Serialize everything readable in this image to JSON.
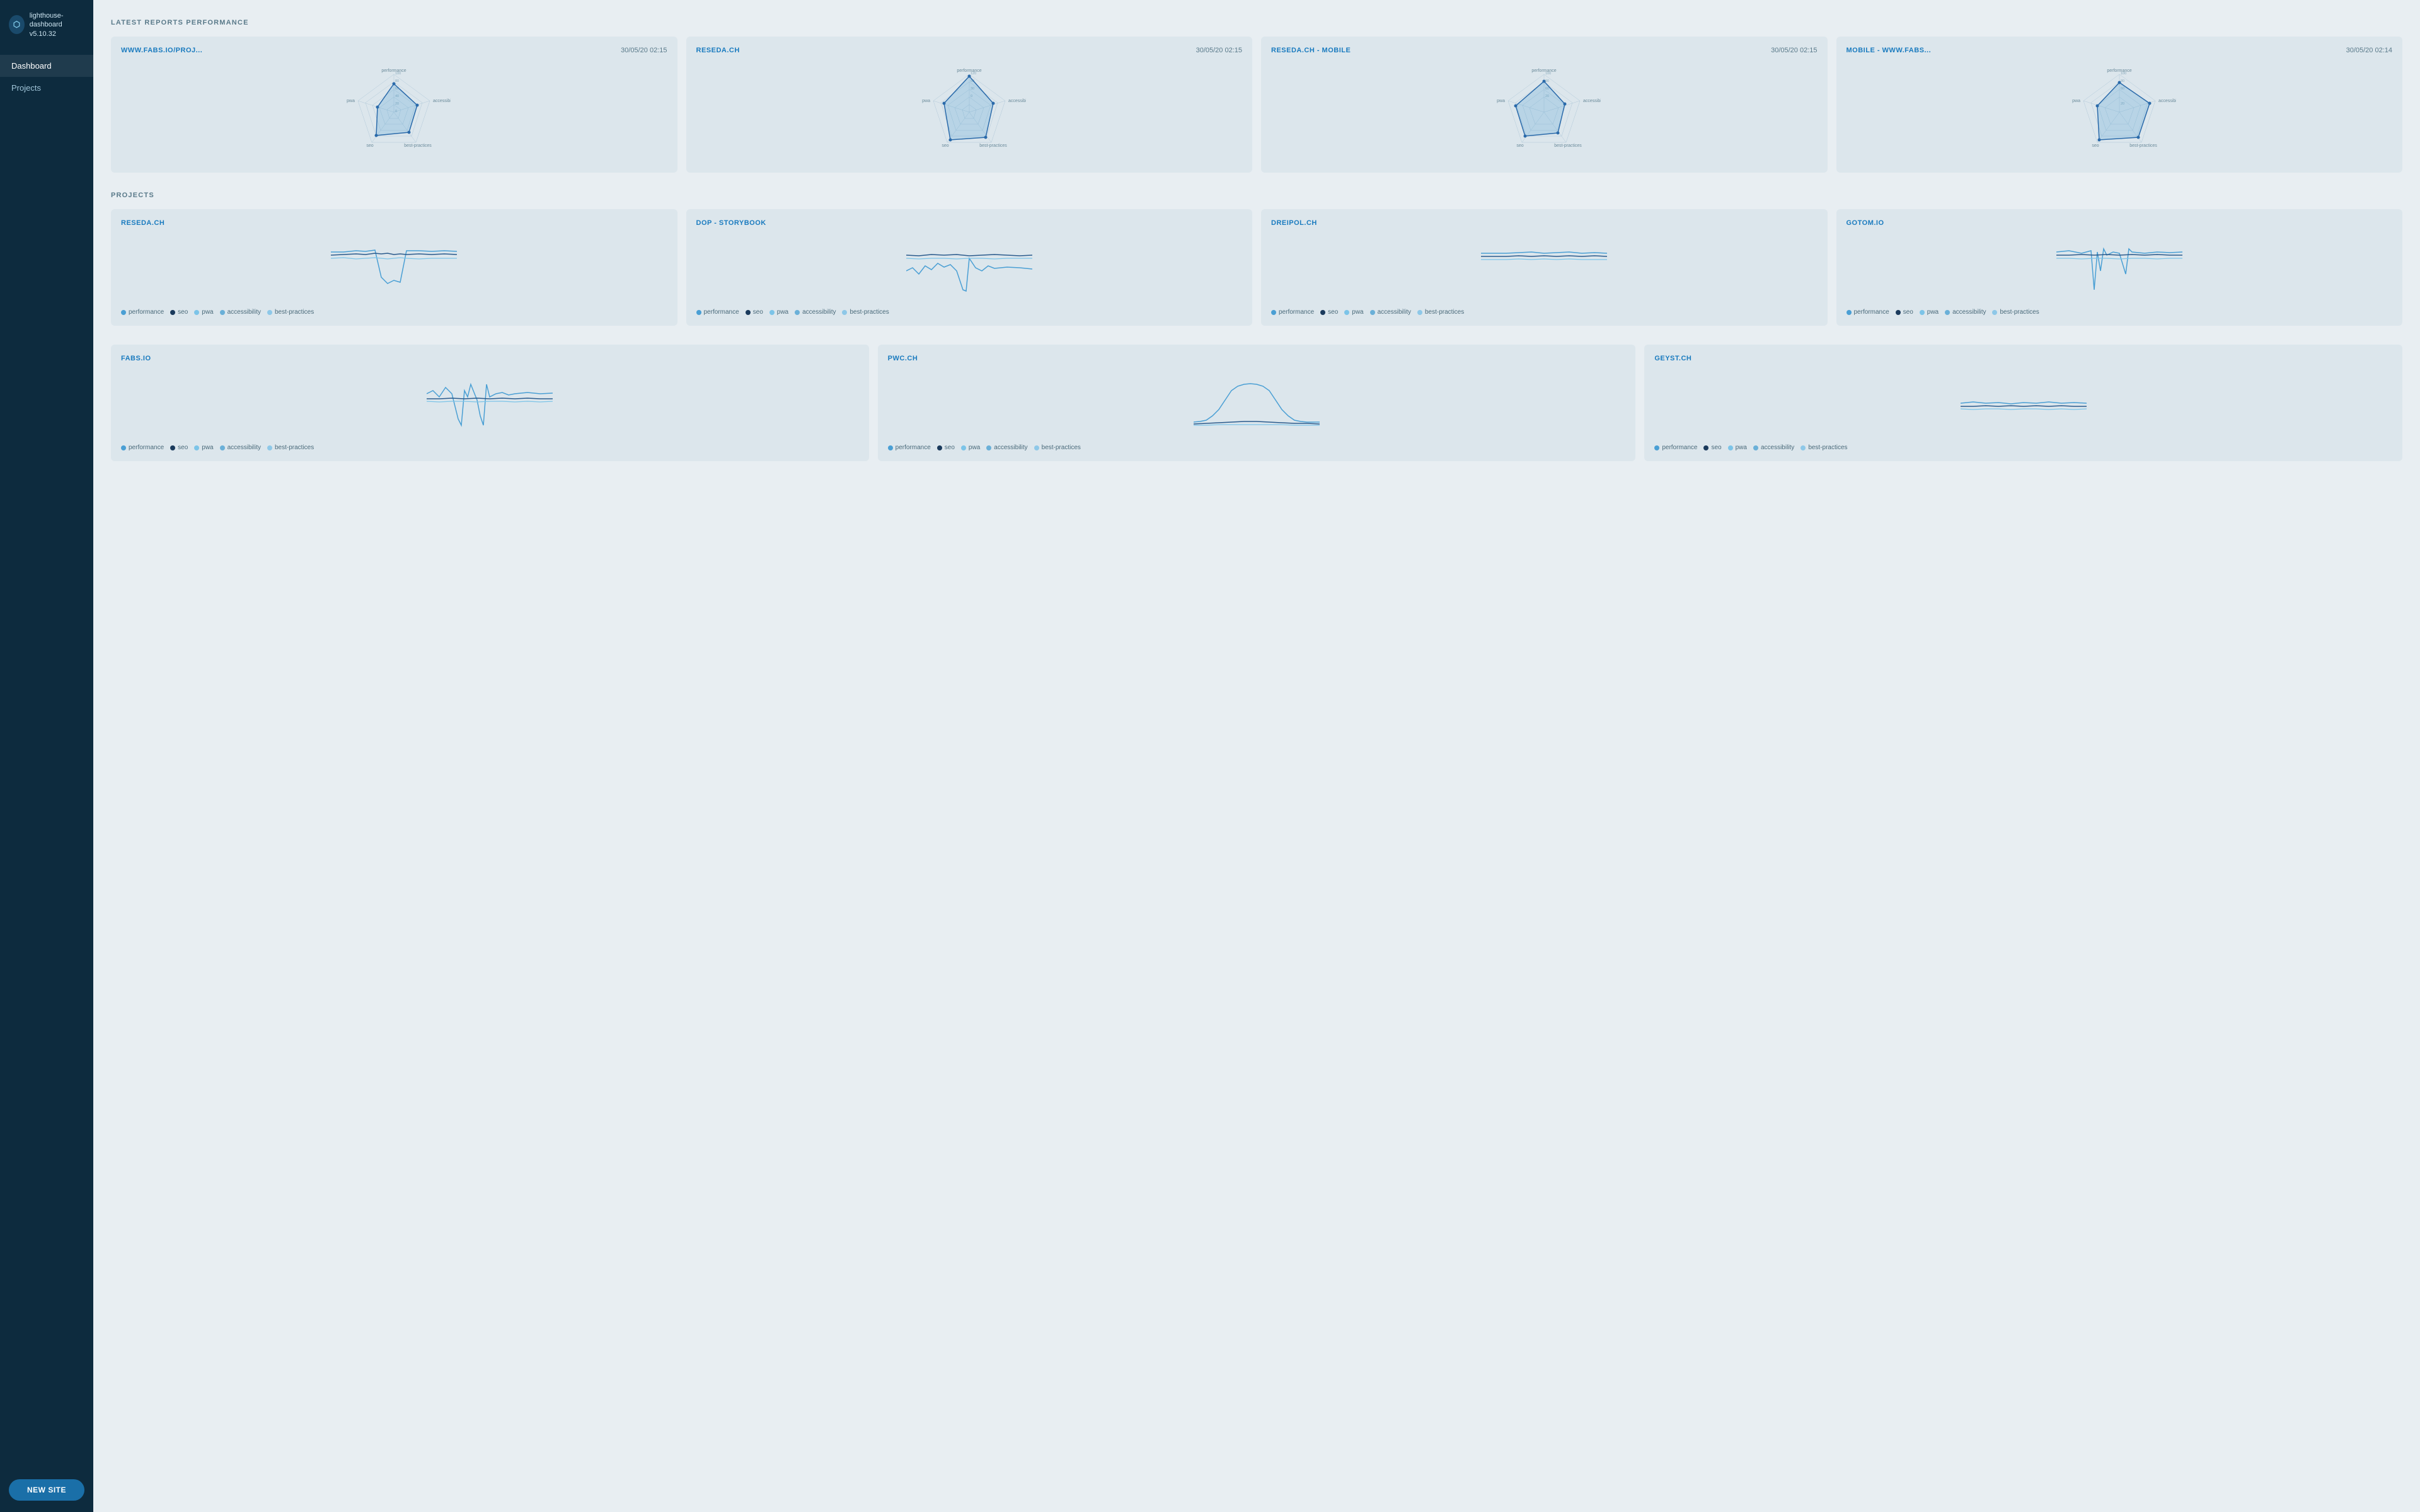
{
  "app": {
    "name": "lighthouse-dashboard",
    "version": "v5.10.32"
  },
  "sidebar": {
    "nav_items": [
      {
        "id": "dashboard",
        "label": "Dashboard",
        "active": true
      },
      {
        "id": "projects",
        "label": "Projects",
        "active": false
      }
    ],
    "new_site_label": "NEW SITE"
  },
  "latest_reports": {
    "section_title": "LATEST REPORTS PERFORMANCE",
    "cards": [
      {
        "id": "report-1",
        "title": "WWW.FABS.IO/PROJ...",
        "date": "30/05/20 02:15",
        "radar_data": {
          "performance": 75,
          "accessibility": 70,
          "best_practices": 65,
          "seo": 80,
          "pwa": 45
        }
      },
      {
        "id": "report-2",
        "title": "RESEDA.CH",
        "date": "30/05/20 02:15",
        "radar_data": {
          "performance": 95,
          "accessibility": 75,
          "best_practices": 70,
          "seo": 80,
          "pwa": 60
        }
      },
      {
        "id": "report-3",
        "title": "RESEDA.CH - MOBILE",
        "date": "30/05/20 02:15",
        "radar_data": {
          "performance": 82,
          "accessibility": 72,
          "best_practices": 68,
          "seo": 78,
          "pwa": 50
        }
      },
      {
        "id": "report-4",
        "title": "MOBILE - WWW.FABS...",
        "date": "30/05/20 02:14",
        "radar_data": {
          "performance": 78,
          "accessibility": 85,
          "best_practices": 75,
          "seo": 88,
          "pwa": 55
        }
      }
    ]
  },
  "projects": {
    "section_title": "PROJECTS",
    "cards": [
      {
        "id": "proj-reseda",
        "title": "RESEDA.CH",
        "legend": [
          {
            "label": "performance",
            "color": "#4a9fd4"
          },
          {
            "label": "seo",
            "color": "#1a3a5c"
          },
          {
            "label": "pwa",
            "color": "#7cc4e8"
          },
          {
            "label": "accessibility",
            "color": "#6ab0d8"
          },
          {
            "label": "best-practices",
            "color": "#8ec8e8"
          }
        ]
      },
      {
        "id": "proj-dop",
        "title": "DOP - STORYBOOK",
        "legend": [
          {
            "label": "performance",
            "color": "#4a9fd4"
          },
          {
            "label": "seo",
            "color": "#1a3a5c"
          },
          {
            "label": "pwa",
            "color": "#7cc4e8"
          },
          {
            "label": "accessibility",
            "color": "#6ab0d8"
          },
          {
            "label": "best-practices",
            "color": "#8ec8e8"
          }
        ]
      },
      {
        "id": "proj-dreipol",
        "title": "DREIPOL.CH",
        "legend": [
          {
            "label": "performance",
            "color": "#4a9fd4"
          },
          {
            "label": "seo",
            "color": "#1a3a5c"
          },
          {
            "label": "pwa",
            "color": "#7cc4e8"
          },
          {
            "label": "accessibility",
            "color": "#6ab0d8"
          },
          {
            "label": "best-practices",
            "color": "#8ec8e8"
          }
        ]
      },
      {
        "id": "proj-gotom",
        "title": "GOTOM.IO",
        "legend": [
          {
            "label": "performance",
            "color": "#4a9fd4"
          },
          {
            "label": "seo",
            "color": "#1a3a5c"
          },
          {
            "label": "pwa",
            "color": "#7cc4e8"
          },
          {
            "label": "accessibility",
            "color": "#6ab0d8"
          },
          {
            "label": "best-practices",
            "color": "#8ec8e8"
          }
        ]
      },
      {
        "id": "proj-fabs",
        "title": "FABS.IO",
        "legend": [
          {
            "label": "performance",
            "color": "#4a9fd4"
          },
          {
            "label": "seo",
            "color": "#1a3a5c"
          },
          {
            "label": "pwa",
            "color": "#7cc4e8"
          },
          {
            "label": "accessibility",
            "color": "#6ab0d8"
          },
          {
            "label": "best-practices",
            "color": "#8ec8e8"
          }
        ]
      },
      {
        "id": "proj-pwc",
        "title": "PWC.CH",
        "legend": [
          {
            "label": "performance",
            "color": "#4a9fd4"
          },
          {
            "label": "seo",
            "color": "#1a3a5c"
          },
          {
            "label": "pwa",
            "color": "#7cc4e8"
          },
          {
            "label": "accessibility",
            "color": "#6ab0d8"
          },
          {
            "label": "best-practices",
            "color": "#8ec8e8"
          }
        ]
      },
      {
        "id": "proj-geyst",
        "title": "GEYST.CH",
        "legend": [
          {
            "label": "performance",
            "color": "#4a9fd4"
          },
          {
            "label": "seo",
            "color": "#1a3a5c"
          },
          {
            "label": "pwa",
            "color": "#7cc4e8"
          },
          {
            "label": "accessibility",
            "color": "#6ab0d8"
          },
          {
            "label": "best-practices",
            "color": "#8ec8e8"
          }
        ]
      }
    ]
  },
  "colors": {
    "accent": "#1a7bbf",
    "sidebar_bg": "#0d2b3e",
    "card_bg": "#dce6ec",
    "text_muted": "#5a7a8a"
  }
}
